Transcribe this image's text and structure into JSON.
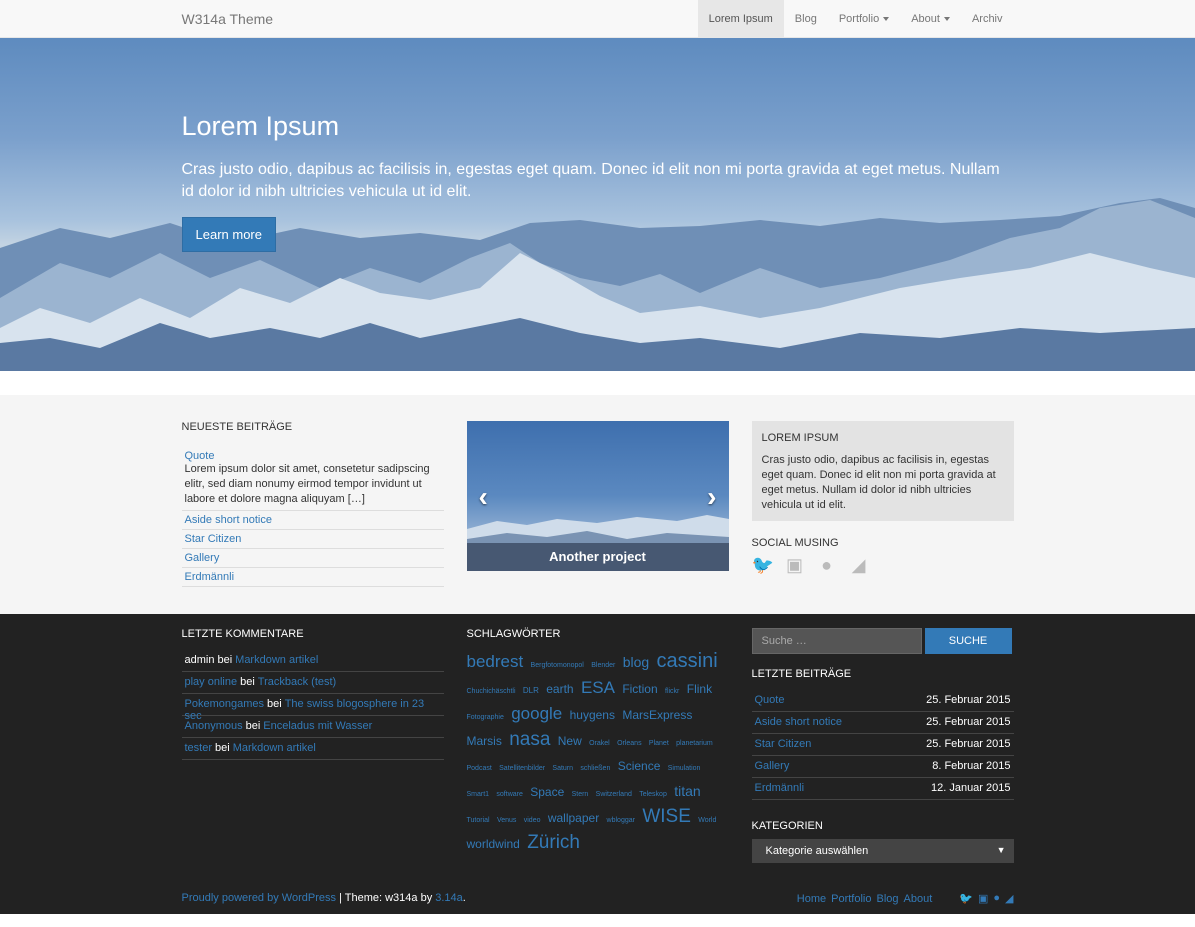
{
  "navbar": {
    "brand": "W314a Theme",
    "items": [
      {
        "label": "Lorem Ipsum",
        "active": true,
        "dropdown": false
      },
      {
        "label": "Blog",
        "active": false,
        "dropdown": false
      },
      {
        "label": "Portfolio",
        "active": false,
        "dropdown": true
      },
      {
        "label": "About",
        "active": false,
        "dropdown": true
      },
      {
        "label": "Archiv",
        "active": false,
        "dropdown": false
      }
    ]
  },
  "hero": {
    "title": "Lorem Ipsum",
    "text": "Cras justo odio, dapibus ac facilisis in, egestas eget quam. Donec id elit non mi porta gravida at eget metus. Nullam id dolor id nibh ultricies vehicula ut id elit.",
    "button": "Learn more"
  },
  "latest": {
    "title": "NEUESTE BEITRÄGE",
    "first": {
      "title": "Quote",
      "excerpt": "Lorem ipsum dolor sit amet, consetetur sadipscing elitr, sed diam nonumy eirmod tempor invidunt ut labore et dolore magna aliquyam […]"
    },
    "items": [
      "Aside short notice",
      "Star Citizen",
      "Gallery",
      "Erdmännli"
    ]
  },
  "carousel": {
    "caption": "Another project",
    "prev": "‹",
    "next": "›"
  },
  "well": {
    "title": "LOREM IPSUM",
    "text": "Cras justo odio, dapibus ac facilisis in, egestas eget quam. Donec id elit non mi porta gravida at eget metus. Nullam id dolor id nibh ultricies vehicula ut id elit."
  },
  "social": {
    "title": "SOCIAL MUSING",
    "icons": [
      "twitter-icon",
      "instagram-icon",
      "github-icon",
      "rss-icon"
    ]
  },
  "comments": {
    "title": "LETZTE KOMMENTARE",
    "items": [
      {
        "author": "admin",
        "by": "bei",
        "post": "Markdown artikel",
        "author_link": false
      },
      {
        "author": "play online",
        "by": "bei",
        "post": "Trackback (test)",
        "author_link": true
      },
      {
        "author": "Pokemongames",
        "by": "bei",
        "post": "The swiss blogosphere in 23 sec",
        "author_link": true
      },
      {
        "author": "Anonymous",
        "by": "bei",
        "post": "Enceladus mit Wasser",
        "author_link": true
      },
      {
        "author": "tester",
        "by": "bei",
        "post": "Markdown artikel",
        "author_link": true
      }
    ]
  },
  "tags": {
    "title": "SCHLAGWÖRTER",
    "items": [
      {
        "t": "bedrest",
        "s": 17
      },
      {
        "t": "Bergfotomonopol",
        "s": 7
      },
      {
        "t": "Blender",
        "s": 7
      },
      {
        "t": "blog",
        "s": 14
      },
      {
        "t": "cassini",
        "s": 20
      },
      {
        "t": "Chuchichäschtli",
        "s": 7
      },
      {
        "t": "DLR",
        "s": 8
      },
      {
        "t": "earth",
        "s": 12
      },
      {
        "t": "ESA",
        "s": 17
      },
      {
        "t": "Fiction",
        "s": 12
      },
      {
        "t": "flickr",
        "s": 7
      },
      {
        "t": "Flink",
        "s": 12
      },
      {
        "t": "Fotographie",
        "s": 7
      },
      {
        "t": "google",
        "s": 17
      },
      {
        "t": "huygens",
        "s": 12
      },
      {
        "t": "MarsExpress",
        "s": 12
      },
      {
        "t": "Marsis",
        "s": 12
      },
      {
        "t": "nasa",
        "s": 19
      },
      {
        "t": "New",
        "s": 12
      },
      {
        "t": "Orakel",
        "s": 7
      },
      {
        "t": "Orleans",
        "s": 7
      },
      {
        "t": "Planet",
        "s": 7
      },
      {
        "t": "planetarium",
        "s": 7
      },
      {
        "t": "Podcast",
        "s": 7
      },
      {
        "t": "Satellitenbilder",
        "s": 7
      },
      {
        "t": "Saturn",
        "s": 7
      },
      {
        "t": "schließen",
        "s": 7
      },
      {
        "t": "Science",
        "s": 12
      },
      {
        "t": "Simulation",
        "s": 7
      },
      {
        "t": "Smart1",
        "s": 7
      },
      {
        "t": "software",
        "s": 7
      },
      {
        "t": "Space",
        "s": 12
      },
      {
        "t": "Stern",
        "s": 7
      },
      {
        "t": "Switzerland",
        "s": 7
      },
      {
        "t": "Teleskop",
        "s": 7
      },
      {
        "t": "titan",
        "s": 14
      },
      {
        "t": "Tutorial",
        "s": 7
      },
      {
        "t": "Venus",
        "s": 7
      },
      {
        "t": "video",
        "s": 7
      },
      {
        "t": "wallpaper",
        "s": 12
      },
      {
        "t": "wbloggar",
        "s": 7
      },
      {
        "t": "WISE",
        "s": 19
      },
      {
        "t": "World",
        "s": 7
      },
      {
        "t": "worldwind",
        "s": 12
      },
      {
        "t": "Zürich",
        "s": 19
      }
    ]
  },
  "search": {
    "placeholder": "Suche …",
    "button": "SUCHE"
  },
  "recent": {
    "title": "LETZTE BEITRÄGE",
    "items": [
      {
        "title": "Quote",
        "date": "25. Februar 2015"
      },
      {
        "title": "Aside short notice",
        "date": "25. Februar 2015"
      },
      {
        "title": "Star Citizen",
        "date": "25. Februar 2015"
      },
      {
        "title": "Gallery",
        "date": "8. Februar 2015"
      },
      {
        "title": "Erdmännli",
        "date": "12. Januar 2015"
      }
    ]
  },
  "categories": {
    "title": "KATEGORIEN",
    "selected": "Kategorie auswählen"
  },
  "footer": {
    "powered": "Proudly powered by WordPress",
    "sep": " | Theme: w314a by ",
    "author": "3.14a",
    "dot": ".",
    "links": [
      "Home",
      "Portfolio",
      "Blog",
      "About"
    ]
  },
  "colors": {
    "accent": "#337ab7",
    "dark_bg": "#222222",
    "light_bg": "#f5f5f5"
  }
}
